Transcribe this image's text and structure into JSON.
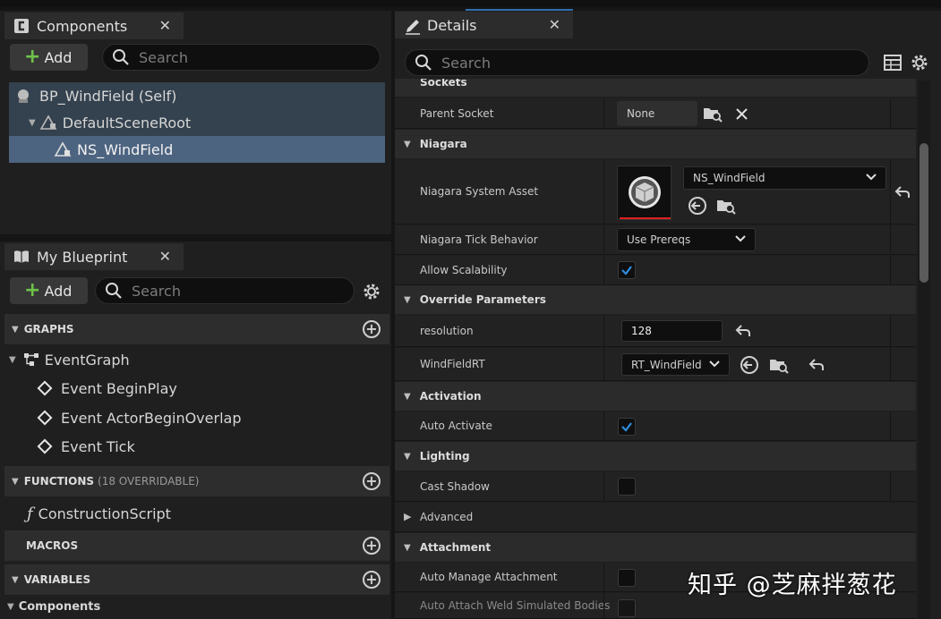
{
  "components": {
    "tab_title": "Components",
    "add_label": "Add",
    "search_placeholder": "Search",
    "tree": [
      {
        "label": "BP_WindField (Self)"
      },
      {
        "label": "DefaultSceneRoot"
      },
      {
        "label": "NS_WindField"
      }
    ]
  },
  "my_blueprint": {
    "tab_title": "My Blueprint",
    "add_label": "Add",
    "search_placeholder": "Search",
    "sections": {
      "graphs": "GRAPHS",
      "functions": "FUNCTIONS",
      "functions_sub": "(18 OVERRIDABLE)",
      "macros": "MACROS",
      "variables": "VARIABLES",
      "components": "Components"
    },
    "graph": "EventGraph",
    "events": [
      "Event BeginPlay",
      "Event ActorBeginOverlap",
      "Event Tick"
    ],
    "function": "ConstructionScript"
  },
  "details": {
    "tab_title": "Details",
    "search_placeholder": "Search",
    "categories": {
      "sockets": "Sockets",
      "niagara": "Niagara",
      "override": "Override Parameters",
      "activation": "Activation",
      "lighting": "Lighting",
      "advanced": "Advanced",
      "attachment": "Attachment"
    },
    "rows": {
      "parent_socket": {
        "label": "Parent Socket",
        "value": "None"
      },
      "system_asset": {
        "label": "Niagara System Asset",
        "value": "NS_WindField"
      },
      "tick_behavior": {
        "label": "Niagara Tick Behavior",
        "value": "Use Prereqs"
      },
      "allow_scalability": {
        "label": "Allow Scalability",
        "checked": true
      },
      "resolution": {
        "label": "resolution",
        "value": "128"
      },
      "windfield_rt": {
        "label": "WindFieldRT",
        "value": "RT_WindField"
      },
      "auto_activate": {
        "label": "Auto Activate",
        "checked": true
      },
      "cast_shadow": {
        "label": "Cast Shadow",
        "checked": false
      },
      "auto_manage": {
        "label": "Auto Manage Attachment",
        "checked": false
      },
      "auto_weld": {
        "label": "Auto Attach Weld Simulated Bodies"
      }
    }
  },
  "watermark": "知乎 @芝麻拌葱花",
  "colors": {
    "selection": "#4d6480",
    "hover": "#34414e",
    "add_plus": "#6ec34a",
    "check": "#2f8fe0",
    "asset_underline": "#e02020"
  }
}
